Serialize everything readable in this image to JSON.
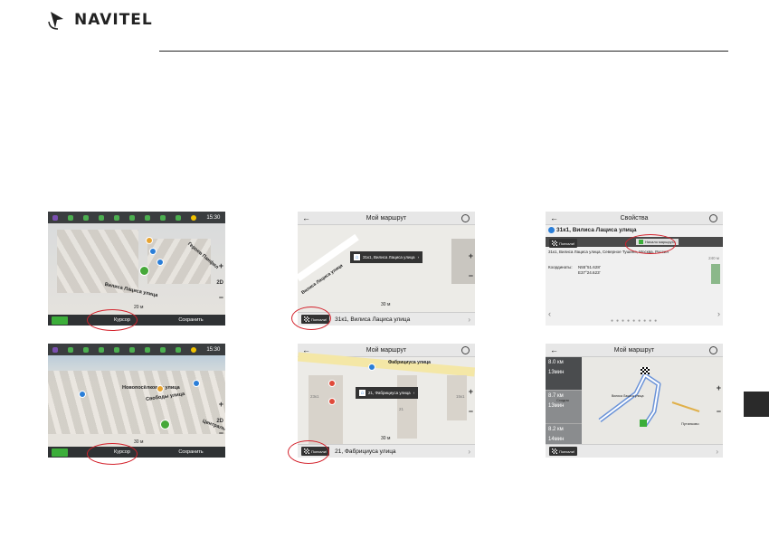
{
  "brand": {
    "name": "NAVITEL"
  },
  "shot1": {
    "clock": "15:30",
    "street_a": "Вилиса Лациса улица",
    "street_b": "Героев Панфил",
    "cursor_label": "Курсор",
    "save_label": "Сохранить",
    "zoom_2d": "2D",
    "scale": "20 м"
  },
  "shot2": {
    "title": "Мой маршрут",
    "popup_text": "31к1, Вилиса Лациса улица",
    "street": "Вилиса Лациса улица",
    "scale": "30 м",
    "go_label": "Поехали!",
    "address": "31к1, Вилиса Лациса улица"
  },
  "shot3": {
    "title": "Свойства",
    "heading": "31к1, Вилиса Лациса улица",
    "go_label": "Поехали!",
    "start_label": "Начало маршрута",
    "desc": "31к1, Вилиса Лациса улица, Северное Тушино, Москва, Россия",
    "distance": "240 м",
    "coords_label": "Координаты:",
    "coord_n": "N55°51.628'",
    "coord_e": "E37°24.623'"
  },
  "shot4": {
    "clock": "15:30",
    "street_a": "Новопосёлковая улица",
    "street_b": "Свободы улица",
    "street_c": "Центральн",
    "cursor_label": "Курсор",
    "save_label": "Сохранить",
    "zoom_2d": "2D",
    "scale": "30 м"
  },
  "shot5": {
    "title": "Мой маршрут",
    "popup_text": "21, Фабрициуса улица",
    "street": "Фабрициуса улица",
    "scale": "30 м",
    "go_label": "Поехали!",
    "address": "21, Фабрициуса улица",
    "house_a": "23к1",
    "house_b": "15к1",
    "house_c": "21"
  },
  "shot6": {
    "title": "Мой маршрут",
    "go_label": "Поехали!",
    "r1_dist": "8.0 км",
    "r1_time": "13мин",
    "r2_dist": "8.7 км",
    "r2_time": "13мин",
    "r3_dist": "8.2 км",
    "r3_time": "14мин",
    "place_a": "Сходня",
    "place_b": "Путилково",
    "place_c": "Вилиса Лациса улица"
  }
}
